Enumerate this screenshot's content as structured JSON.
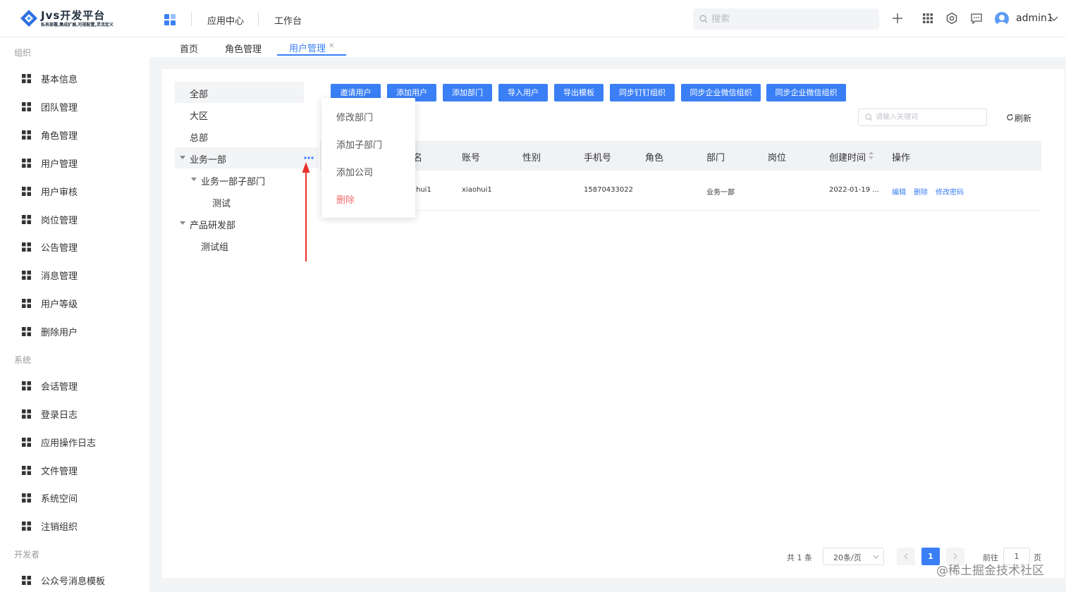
{
  "header": {
    "logo_title": "Jvs开发平台",
    "logo_subtitle": "私有部署,集成扩展,可视配置,灵活定义",
    "nav": [
      "应用中心",
      "工作台"
    ],
    "search_placeholder": "搜索",
    "username": "admin1"
  },
  "sidebar": {
    "groups": [
      {
        "title": "组织",
        "items": [
          "基本信息",
          "团队管理",
          "角色管理",
          "用户管理",
          "用户审核",
          "岗位管理",
          "公告管理",
          "消息管理",
          "用户等级",
          "删除用户"
        ]
      },
      {
        "title": "系统",
        "items": [
          "会话管理",
          "登录日志",
          "应用操作日志",
          "文件管理",
          "系统空间",
          "注销组织"
        ]
      },
      {
        "title": "开发者",
        "items": [
          "公众号消息模板"
        ]
      }
    ]
  },
  "tabs": [
    "首页",
    "角色管理",
    "用户管理"
  ],
  "active_tab": "用户管理",
  "tree": {
    "nodes": [
      "全部",
      "大区",
      "总部",
      "业务一部",
      "业务一部子部门",
      "测试",
      "产品研发部",
      "测试组"
    ]
  },
  "context_menu": {
    "items": [
      "修改部门",
      "添加子部门",
      "添加公司",
      "删除"
    ]
  },
  "actions": [
    "邀请用户",
    "添加用户",
    "添加部门",
    "导入用户",
    "导出模板",
    "同步钉钉组织",
    "同步企业微信组织",
    "同步企业微信组织"
  ],
  "keyword_placeholder": "请输入关键词",
  "refresh_label": "刷新",
  "table": {
    "columns": [
      "名",
      "账号",
      "性别",
      "手机号",
      "角色",
      "部门",
      "岗位",
      "创建时间",
      "操作"
    ],
    "rows": [
      {
        "name": "hui1",
        "account": "xiaohui1",
        "gender": "",
        "phone": "15870433022",
        "role": "",
        "dept": "业务一部",
        "post": "",
        "created": "2022-01-19 ...",
        "ops": [
          "编辑",
          "删除",
          "修改密码"
        ]
      }
    ]
  },
  "pagination": {
    "total": "共 1 条",
    "page_size": "20条/页",
    "current_page": "1",
    "goto_prefix": "前往",
    "goto_value": "1",
    "goto_suffix": "页"
  },
  "watermark_credit": "@稀土掘金技术社区",
  "colors": {
    "primary": "#3a7ff6",
    "danger": "#f56c6c",
    "annotation_arrow": "#e8302a"
  }
}
